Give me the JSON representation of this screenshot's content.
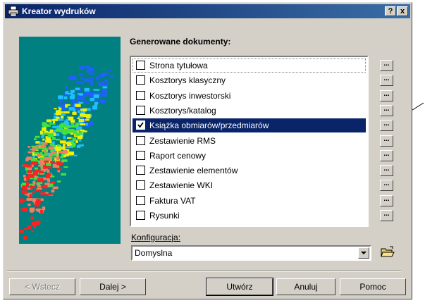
{
  "window": {
    "title": "Kreator wydruków",
    "help_label": "?",
    "close_label": "x"
  },
  "documents": {
    "title": "Generowane dokumenty:",
    "items": [
      {
        "label": "Strona tytułowa",
        "checked": false
      },
      {
        "label": "Kosztorys klasyczny",
        "checked": false
      },
      {
        "label": "Kosztorys inwestorski",
        "checked": false
      },
      {
        "label": "Kosztorys/katalog",
        "checked": false
      },
      {
        "label": "Książka obmiarów/przedmiarów",
        "checked": true
      },
      {
        "label": "Zestawienie RMS",
        "checked": false
      },
      {
        "label": "Raport cenowy",
        "checked": false
      },
      {
        "label": "Zestawienie elementów",
        "checked": false
      },
      {
        "label": "Zestawienie WKI",
        "checked": false
      },
      {
        "label": "Faktura VAT",
        "checked": false
      },
      {
        "label": "Rysunki",
        "checked": false
      }
    ],
    "selected_index": 4,
    "more_button_label": "..."
  },
  "config": {
    "label": "Konfiguracja:",
    "value": "Domyslna"
  },
  "buttons": {
    "back": "< Wstecz",
    "next": "Dalej >",
    "create": "Utwórz",
    "cancel": "Anuluj",
    "help": "Pomoc"
  },
  "colors": {
    "dialog_face": "#d4d0c8",
    "titlebar": "#0a246a",
    "selection": "#0a246a",
    "preview_background": "#008080"
  }
}
